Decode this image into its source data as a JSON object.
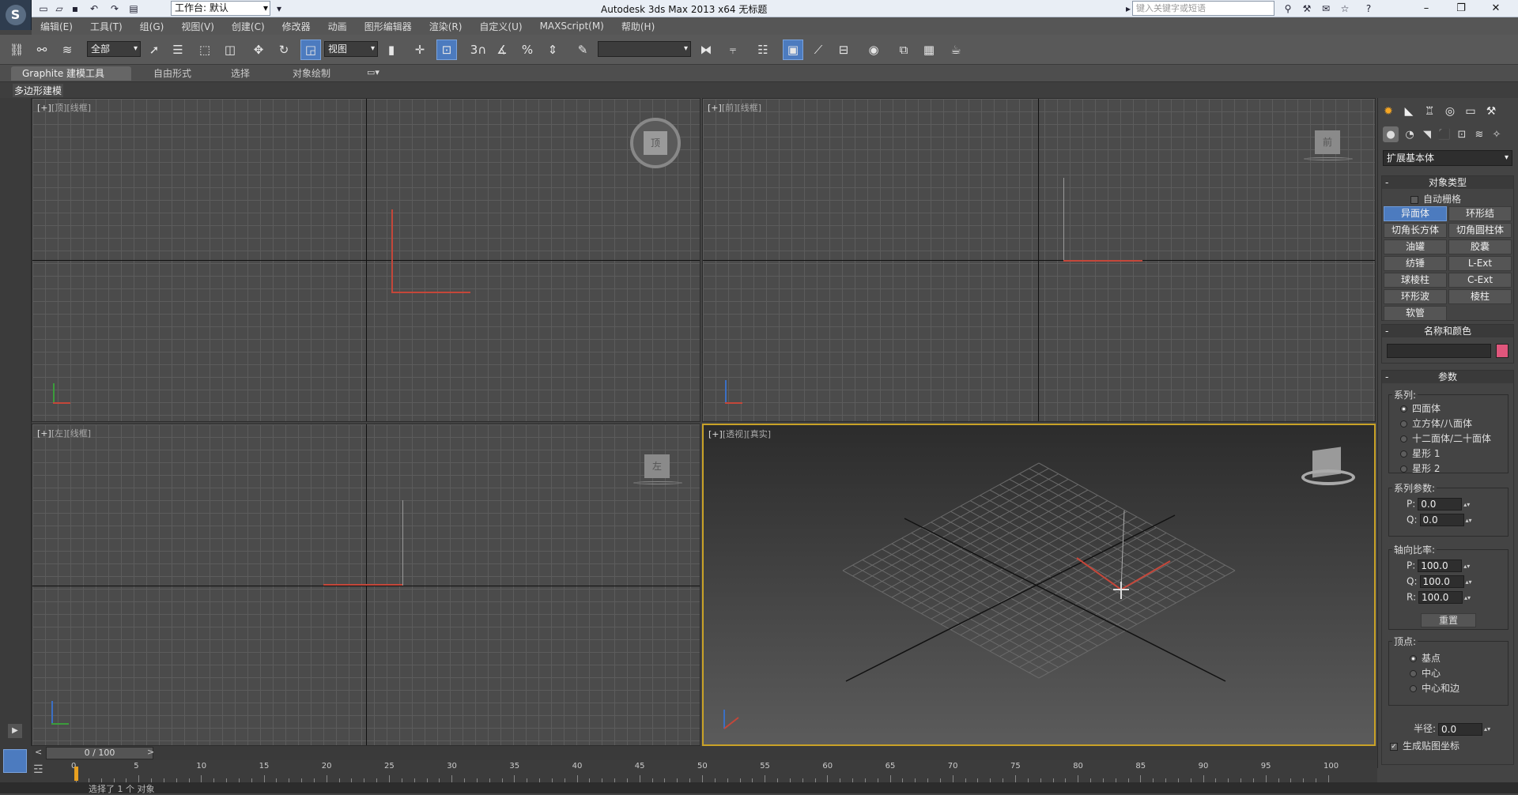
{
  "titlebar": {
    "workspace_label": "工作台: 默认",
    "title": "Autodesk 3ds Max  2013 x64      无标题",
    "search_placeholder": "键入关键字或短语",
    "minimize": "–",
    "restore": "❐",
    "close": "✕"
  },
  "menu": [
    "编辑(E)",
    "工具(T)",
    "组(G)",
    "视图(V)",
    "创建(C)",
    "修改器",
    "动画",
    "图形编辑器",
    "渲染(R)",
    "自定义(U)",
    "MAXScript(M)",
    "帮助(H)"
  ],
  "toolbar": {
    "filter_value": "全部",
    "refcoord_value": "视图",
    "snap_label": "3",
    "named_sel_value": ""
  },
  "ribbon": {
    "tabs": [
      "Graphite 建模工具",
      "自由形式",
      "选择",
      "对象绘制"
    ],
    "sub": "多边形建模"
  },
  "viewports": {
    "top": {
      "plus": "[+]",
      "view": "[顶]",
      "mode": "[线框]",
      "gizmo": "顶"
    },
    "front": {
      "plus": "[+]",
      "view": "[前]",
      "mode": "[线框]",
      "gizmo": "前"
    },
    "left": {
      "plus": "[+]",
      "view": "[左]",
      "mode": "[线框]",
      "gizmo": "左"
    },
    "persp": {
      "plus": "[+]",
      "view": "[透视]",
      "mode": "[真实]"
    }
  },
  "cmdpanel": {
    "category": "扩展基本体",
    "object_type": {
      "title": "对象类型",
      "autogrid": "自动栅格",
      "buttons": [
        "异面体",
        "环形结",
        "切角长方体",
        "切角圆柱体",
        "油罐",
        "胶囊",
        "纺锤",
        "L-Ext",
        "球棱柱",
        "C-Ext",
        "环形波",
        "棱柱",
        "软管"
      ]
    },
    "name_color": {
      "title": "名称和颜色",
      "swatch": "#e0567c"
    },
    "params": {
      "title": "参数",
      "family_label": "系列:",
      "family": [
        "四面体",
        "立方体/八面体",
        "十二面体/二十面体",
        "星形 1",
        "星形 2"
      ],
      "family_params_label": "系列参数:",
      "fp": [
        {
          "k": "P:",
          "v": "0.0"
        },
        {
          "k": "Q:",
          "v": "0.0"
        }
      ],
      "axis_label": "轴向比率:",
      "axis": [
        {
          "k": "P:",
          "v": "100.0"
        },
        {
          "k": "Q:",
          "v": "100.0"
        },
        {
          "k": "R:",
          "v": "100.0"
        }
      ],
      "reset": "重置",
      "vertex_label": "顶点:",
      "vertex": [
        "基点",
        "中心",
        "中心和边"
      ],
      "radius_label": "半径:",
      "radius": "0.0",
      "gen_map": "生成贴图坐标"
    }
  },
  "timeline": {
    "slider": "0 / 100",
    "prev": "<",
    "next": ">",
    "ticks": [
      "0",
      "5",
      "10",
      "15",
      "20",
      "25",
      "30",
      "35",
      "40",
      "45",
      "50",
      "55",
      "60",
      "65",
      "70",
      "75",
      "80",
      "85",
      "90",
      "95",
      "100"
    ]
  },
  "status": {
    "text": "选择了 1 个 对象"
  }
}
